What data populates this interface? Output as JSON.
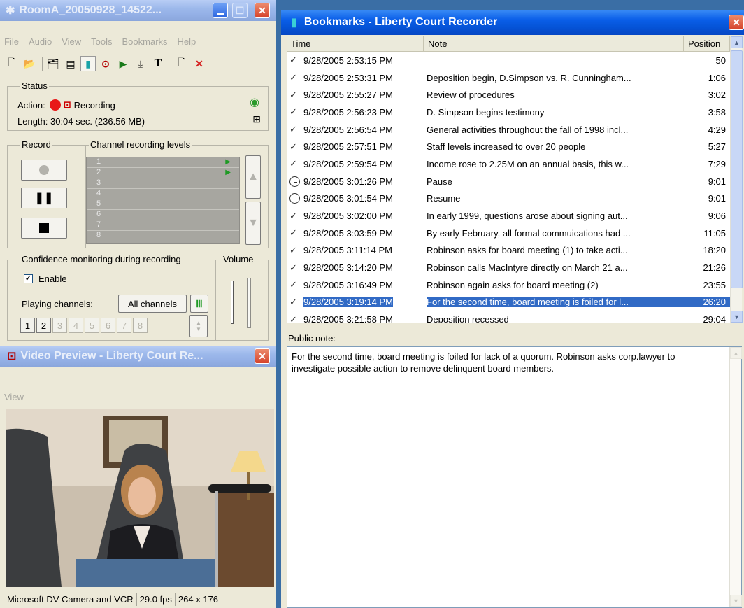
{
  "main_window": {
    "title": "RoomA_20050928_14522...",
    "menu": [
      "File",
      "Audio",
      "View",
      "Tools",
      "Bookmarks",
      "Help"
    ],
    "status": {
      "legend": "Status",
      "action_label": "Action:",
      "action_value": "Recording",
      "length_label": "Length: 30:04 sec. (236.56 MB)"
    },
    "record": {
      "legend": "Record"
    },
    "levels": {
      "legend": "Channel recording levels",
      "channels": [
        "1",
        "2",
        "3",
        "4",
        "5",
        "6",
        "7",
        "8"
      ]
    },
    "confidence": {
      "legend": "Confidence monitoring during recording",
      "enable_label": "Enable",
      "enable_checked": "✓",
      "playing_label": "Playing channels:",
      "all_channels": "All channels",
      "channel_buttons": [
        "1",
        "2",
        "3",
        "4",
        "5",
        "6",
        "7",
        "8"
      ]
    },
    "volume": {
      "legend": "Volume"
    }
  },
  "video_window": {
    "title": "Video Preview - Liberty Court Re...",
    "menu": [
      "View"
    ],
    "status": {
      "device": "Microsoft DV Camera and VCR",
      "fps": "29.0 fps",
      "size": "264 x 176"
    }
  },
  "bookmarks_window": {
    "title": "Bookmarks - Liberty Court Recorder",
    "columns": {
      "time": "Time",
      "note": "Note",
      "position": "Position"
    },
    "rows": [
      {
        "mark": "check",
        "time": "9/28/2005 2:53:15 PM",
        "note": "",
        "position": "50"
      },
      {
        "mark": "check",
        "time": "9/28/2005 2:53:31 PM",
        "note": "Deposition begin, D.Simpson vs. R. Cunningham...",
        "position": "1:06"
      },
      {
        "mark": "check",
        "time": "9/28/2005 2:55:27 PM",
        "note": "Review of procedures",
        "position": "3:02"
      },
      {
        "mark": "check",
        "time": "9/28/2005 2:56:23 PM",
        "note": "D. Simpson begins testimony",
        "position": "3:58"
      },
      {
        "mark": "check",
        "time": "9/28/2005 2:56:54 PM",
        "note": "General activities throughout the fall of 1998 incl...",
        "position": "4:29"
      },
      {
        "mark": "check",
        "time": "9/28/2005 2:57:51 PM",
        "note": "Staff levels increased to over 20 people",
        "position": "5:27"
      },
      {
        "mark": "check",
        "time": "9/28/2005 2:59:54 PM",
        "note": "Income rose to 2.25M on an annual basis, this w...",
        "position": "7:29"
      },
      {
        "mark": "clock",
        "time": "9/28/2005 3:01:26 PM",
        "note": "Pause",
        "position": "9:01"
      },
      {
        "mark": "clock",
        "time": "9/28/2005 3:01:54 PM",
        "note": "Resume",
        "position": "9:01"
      },
      {
        "mark": "check",
        "time": "9/28/2005 3:02:00 PM",
        "note": "In early 1999, questions arose about signing aut...",
        "position": "9:06"
      },
      {
        "mark": "check",
        "time": "9/28/2005 3:03:59 PM",
        "note": "By early February, all formal commuications had ...",
        "position": "11:05"
      },
      {
        "mark": "check",
        "time": "9/28/2005 3:11:14 PM",
        "note": "Robinson asks for board meeting (1) to take acti...",
        "position": "18:20"
      },
      {
        "mark": "check",
        "time": "9/28/2005 3:14:20 PM",
        "note": "Robinson calls MacIntyre directly on March 21 a...",
        "position": "21:26"
      },
      {
        "mark": "check",
        "time": "9/28/2005 3:16:49 PM",
        "note": "Robinson again asks for board meeting (2)",
        "position": "23:55"
      },
      {
        "mark": "check",
        "time": "9/28/2005 3:19:14 PM",
        "note": "For the second time, board meeting is foiled for l...",
        "position": "26:20"
      },
      {
        "mark": "check",
        "time": "9/28/2005 3:21:58 PM",
        "note": "Deposition recessed",
        "position": "29:04"
      }
    ],
    "public_note_label": "Public note:",
    "public_note_text": "For the second time, board meeting is foiled for lack of a quorum. Robinson asks corp.lawyer to investigate possible action to remove delinquent board members."
  },
  "colors": {
    "title_active": "#0553d6",
    "selection": "#316ac5",
    "window_face": "#ece9d8",
    "record_red": "#e81818"
  }
}
